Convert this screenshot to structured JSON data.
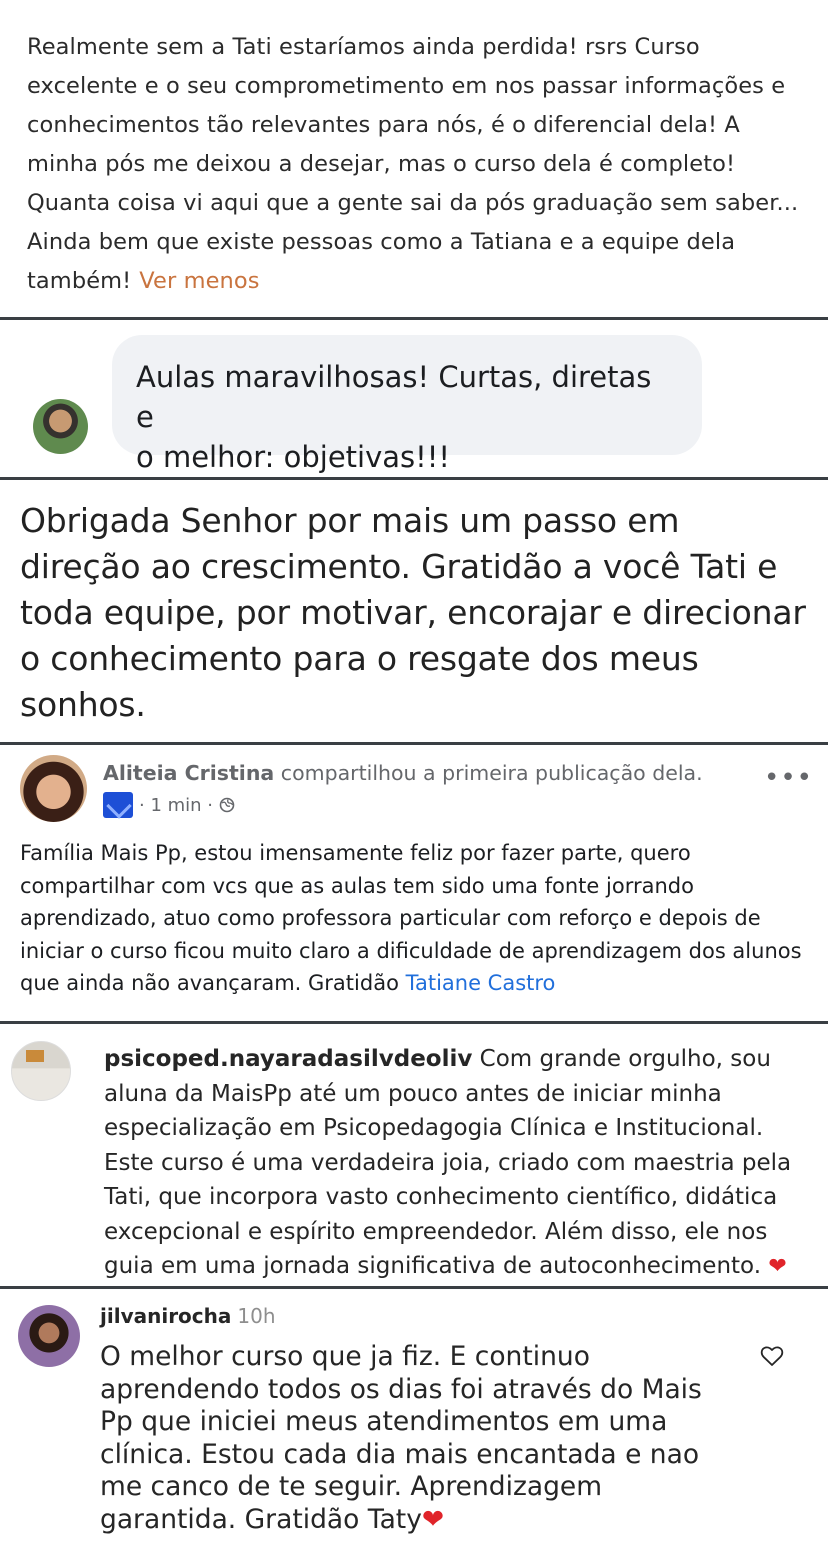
{
  "review1": {
    "text": "Realmente sem a Tati estaríamos ainda perdida! rsrs Curso excelente e o seu comprometimento em nos passar informações e conhecimentos tão relevantes para nós, é o diferencial dela! A minha pós me deixou a desejar, mas o curso dela é completo! Quanta coisa vi aqui que a gente sai da pós graduação sem saber... Ainda bem que existe pessoas como a Tatiana e a equipe dela também!",
    "see_less": "Ver menos"
  },
  "review2": {
    "line1": "Aulas maravilhosas! Curtas, diretas e",
    "line2": "o melhor: objetivas!!!"
  },
  "review3": {
    "text": "Obrigada Senhor por mais um passo em direção ao crescimento. Gratidão a você Tati e toda equipe, por motivar, encorajar e direcionar o conhecimento para o resgate dos meus sonhos."
  },
  "review4": {
    "author": "Aliteia Cristina",
    "action": "compartilhou a primeira publicação dela.",
    "time": "· 1 min ·",
    "more": "•••",
    "text": "Família Mais Pp, estou imensamente feliz  por fazer parte, quero compartilhar com vcs que as aulas tem sido uma fonte jorrando aprendizado, atuo como professora particular com reforço e depois de iniciar o curso ficou muito claro a dificuldade de aprendizagem dos alunos que ainda não avançaram. Gratidão",
    "mention": "Tatiane Castro"
  },
  "review5": {
    "username": "psicoped.nayaradasilvdeoliv",
    "text": "Com grande orgulho, sou aluna da MaisPp até um pouco antes de iniciar minha especialização em Psicopedagogia Clínica e Institucional. Este curso é uma verdadeira joia, criado com maestria pela Tati, que incorpora vasto conhecimento científico, didática excepcional e espírito empreendedor. Além disso, ele nos guia em uma jornada significativa de autoconhecimento.",
    "emoji": "❤"
  },
  "review6": {
    "username": "jilvanirocha",
    "time": "10h",
    "text": "O melhor curso que ja fiz. E continuo aprendendo todos os dias foi através do Mais Pp  que iniciei meus atendimentos em uma clínica.  Estou cada dia mais encantada e nao me canco de te seguir. Aprendizagem garantida. Gratidão Taty",
    "emoji": "❤"
  }
}
